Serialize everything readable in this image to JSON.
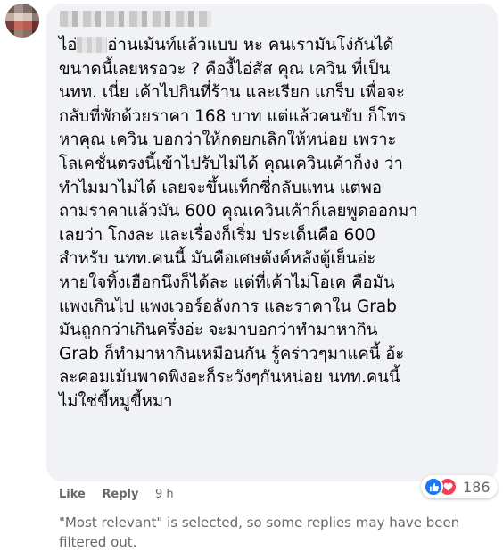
{
  "comment": {
    "author_redacted": true,
    "text_lines": [
      "อ่านเม้นท์แล้วแบบ หะ คนเรามันโง่กันได้",
      "ขนาดนี้เลยหรอวะ ? คืองี้ไอ่สัส คุณ เควิน ที่เป็น",
      "นทท. เนี่ย เค้าไปกินที่ร้าน และเรียก แกร็บ เพื่อจะ",
      "กลับที่พักด้วยราคา 168 บาท แต่แล้วคนขับ ก็โทร",
      "หาคุณ เควิน บอกว่าให้กดยกเลิกให้หน่อย เพราะ",
      "โลเคชั่นตรงนี้เข้าไปรับไม่ได้ คุณเควินเค้าก็งง ว่า",
      "ทำไมมาไม่ได้ เลยจะขึ้นแท็กซี่กลับแทน แต่พอ",
      "ถามราคาแล้วมัน 600 คุณเควินเค้าก็เลยพูดออกมา",
      "เลยว่า โกงละ และเรื่องก็เริ่ม ประเด็นคือ 600",
      "สำหรับ นทท.คนนี้ มันคือเศษตังค์หลังตู้เย็นอ่ะ",
      "หายใจทิ้งเฮือกนึงก็ได้ละ แต่ที่เค้าไม่โอเค คือมัน",
      "แพงเกินไป แพงเวอร์อลังการ และราคาใน Grab",
      "มันถูกกว่าเกินครึ่งอ่ะ จะมาบอกว่าทำมาหากิน",
      "Grab ก็ทำมาหากินเหมือนกัน รู้คร่าวๆมาแค่นี้ อ้ะ",
      "ละคอมเม้นพาดพิงอะก็ระวังๆกันหน่อย นทท.คนนี้",
      "ไม่ใช่ขี้หมูขี้หมา"
    ],
    "first_line_prefix": "ไอ่"
  },
  "actions": {
    "like_label": "Like",
    "reply_label": "Reply",
    "time": "9 h"
  },
  "reactions": {
    "icons": [
      "like-icon",
      "love-icon"
    ],
    "count": "186",
    "colors": {
      "like": "#1877f2",
      "love": "#f33e58"
    }
  },
  "filter_note": "\"Most relevant\" is selected, so some replies may have been filtered out."
}
